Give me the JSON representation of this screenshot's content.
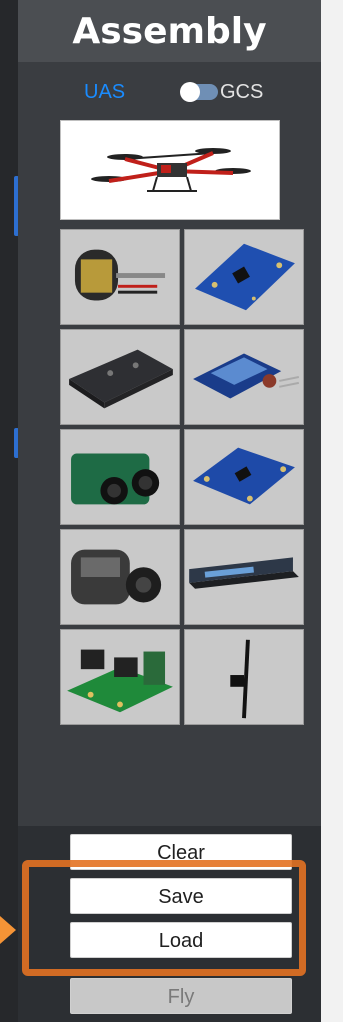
{
  "panel": {
    "title": "Assembly"
  },
  "mode_toggle": {
    "left_label": "UAS",
    "right_label": "GCS",
    "selected": "UAS"
  },
  "components": [
    {
      "icon": "brushless-motor-icon"
    },
    {
      "icon": "imu-sensor-board-icon"
    },
    {
      "icon": "flight-controller-icon"
    },
    {
      "icon": "humidity-sensor-icon"
    },
    {
      "icon": "stereo-camera-icon"
    },
    {
      "icon": "sensor-breakout-board-icon"
    },
    {
      "icon": "gimbal-camera-icon"
    },
    {
      "icon": "lipo-battery-icon"
    },
    {
      "icon": "power-distribution-board-icon"
    },
    {
      "icon": "antenna-icon"
    }
  ],
  "buttons": {
    "clear": "Clear",
    "save": "Save",
    "load": "Load",
    "fly": "Fly"
  },
  "colors": {
    "accent": "#1a8cff",
    "highlight": "#e37222",
    "panel": "#3a3d41"
  }
}
